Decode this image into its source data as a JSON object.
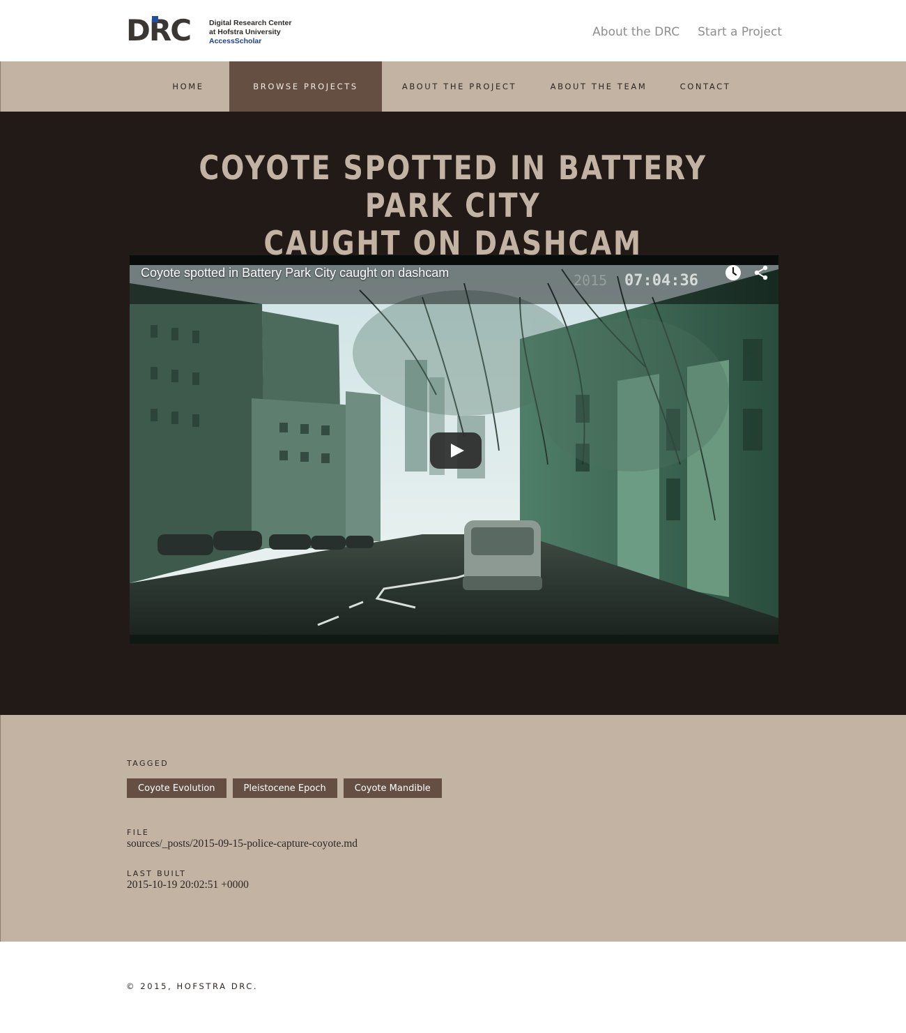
{
  "logo": {
    "mark": "DRC",
    "line1": "Digital Research Center",
    "line2": "at Hofstra University",
    "line3": "AccessScholar"
  },
  "top_links": [
    "About the DRC",
    "Start a Project"
  ],
  "nav": {
    "items": [
      "HOME",
      "BROWSE PROJECTS",
      "ABOUT THE PROJECT",
      "ABOUT THE TEAM",
      "CONTACT"
    ],
    "active": "BROWSE PROJECTS"
  },
  "page": {
    "title_line1": "COYOTE SPOTTED IN BATTERY PARK CITY",
    "title_line2": "CAUGHT ON DASHCAM"
  },
  "video": {
    "title": "Coyote spotted in Battery Park City caught on dashcam",
    "timestamp": "07:04:36",
    "stamp_year": "2015",
    "icons": [
      "watch-later-icon",
      "share-icon",
      "play-icon"
    ]
  },
  "meta": {
    "tagged_label": "TAGGED",
    "tags": [
      "Coyote Evolution",
      "Pleistocene Epoch",
      "Coyote Mandible"
    ],
    "file_label": "FILE",
    "file_value": "sources/_posts/2015-09-15-police-capture-coyote.md",
    "built_label": "LAST BUILT",
    "built_value": "2015-10-19 20:02:51 +0000"
  },
  "footer": {
    "copyright": "© 2015, HOFSTRA DRC."
  },
  "colors": {
    "nav_bg": "#c2b3a3",
    "accent": "#654f42",
    "hero_bg": "#221a16",
    "title": "#c2b3a3",
    "logo_blue": "#1f4fa3"
  }
}
